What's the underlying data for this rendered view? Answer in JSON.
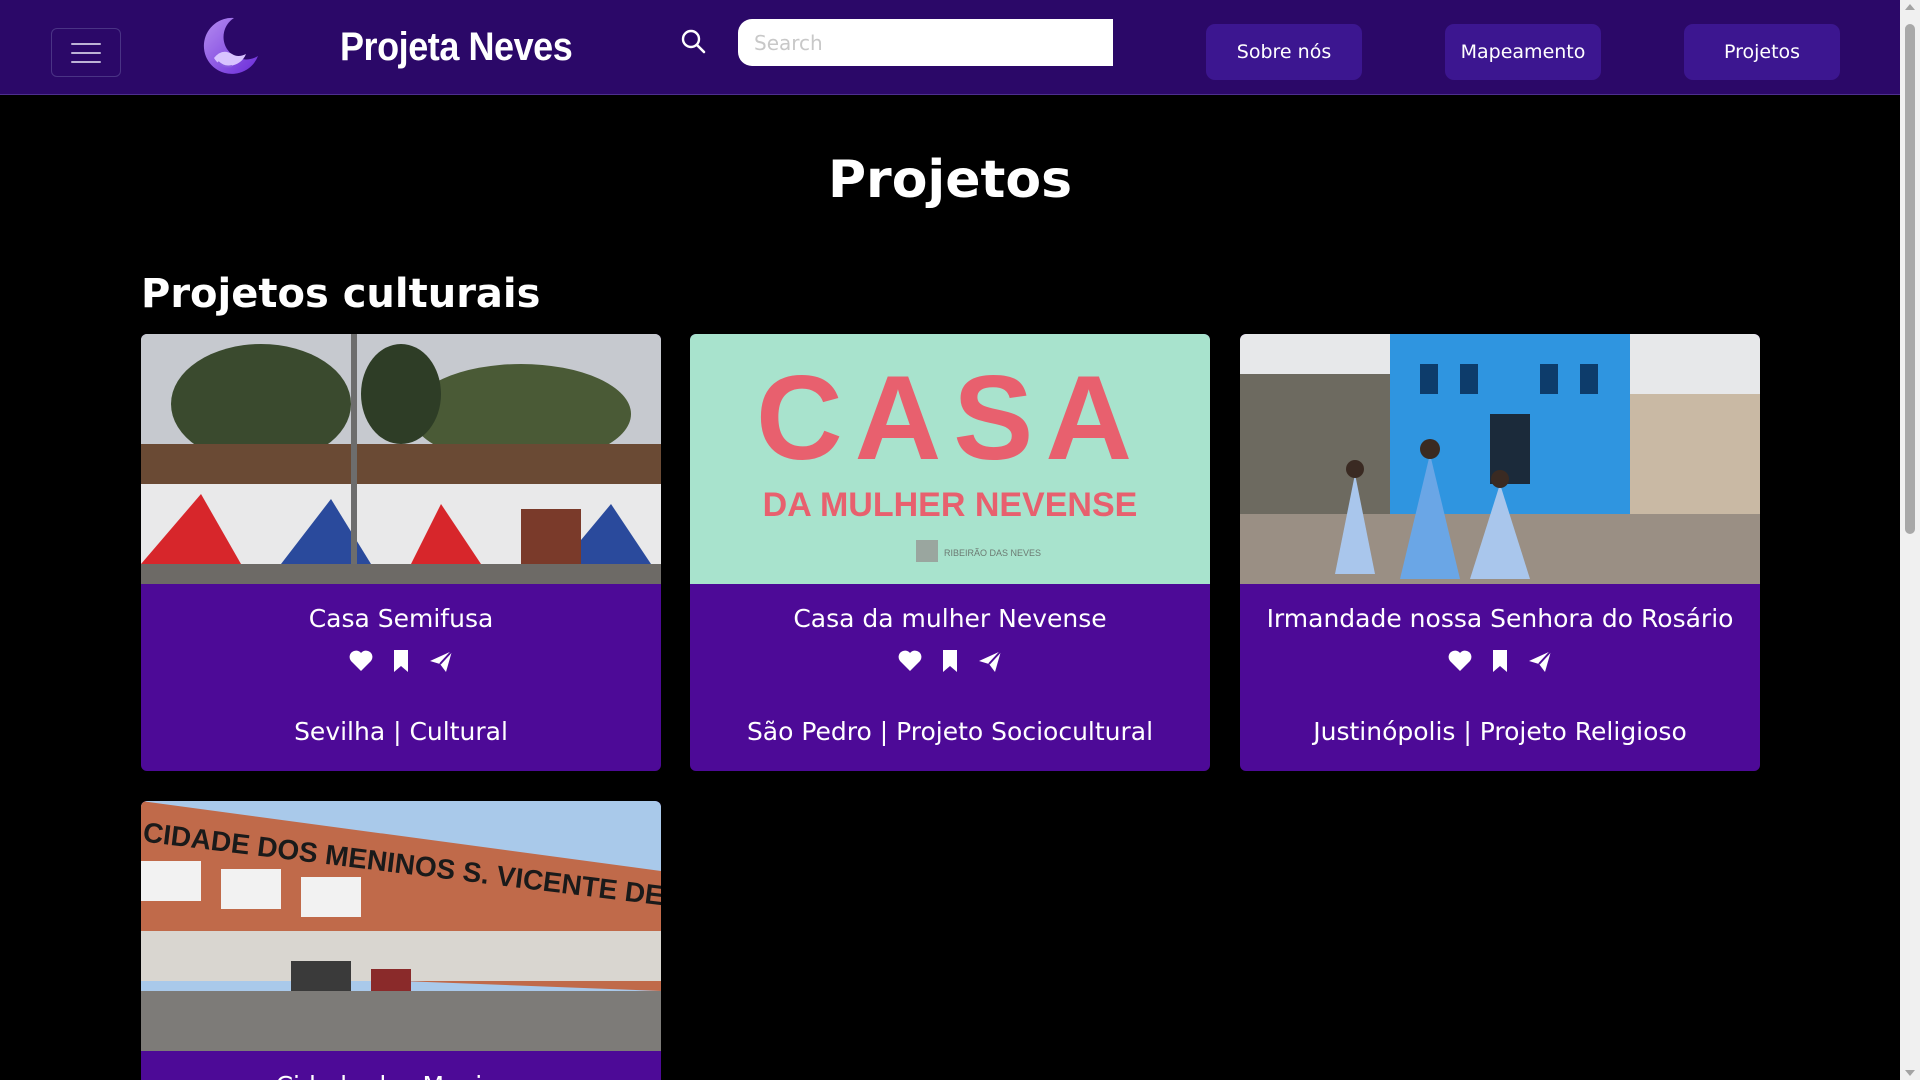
{
  "header": {
    "brand": "Projeta Neves",
    "search_placeholder": "Search",
    "nav": [
      {
        "label": "Sobre nós"
      },
      {
        "label": "Mapeamento"
      },
      {
        "label": "Projetos"
      }
    ]
  },
  "main": {
    "page_title": "Projetos",
    "section_title": "Projetos culturais",
    "cards": [
      {
        "title": "Casa Semifusa",
        "meta": "Sevilha | Cultural"
      },
      {
        "title": "Casa da mulher Nevense",
        "meta": "São Pedro | Projeto Sociocultural",
        "image_text": {
          "big": "CASA",
          "sub": "DA MULHER NEVENSE",
          "seal": "RIBEIRÃO DAS NEVES"
        }
      },
      {
        "title": "Irmandade nossa Senhora do Rosário",
        "meta": "Justinópolis | Projeto Religioso"
      },
      {
        "title": "Cidade dos Meninos",
        "image_text": {
          "sign": "CIDADE DOS MENINOS S. VICENTE DE PAULO"
        }
      }
    ]
  },
  "colors": {
    "navbar": "#2b0868",
    "nav_button": "#3c1690",
    "card": "#4d0a97",
    "background": "#000000"
  },
  "icons": [
    "menu-icon",
    "search-icon",
    "heart-icon",
    "bookmark-icon",
    "send-icon"
  ]
}
